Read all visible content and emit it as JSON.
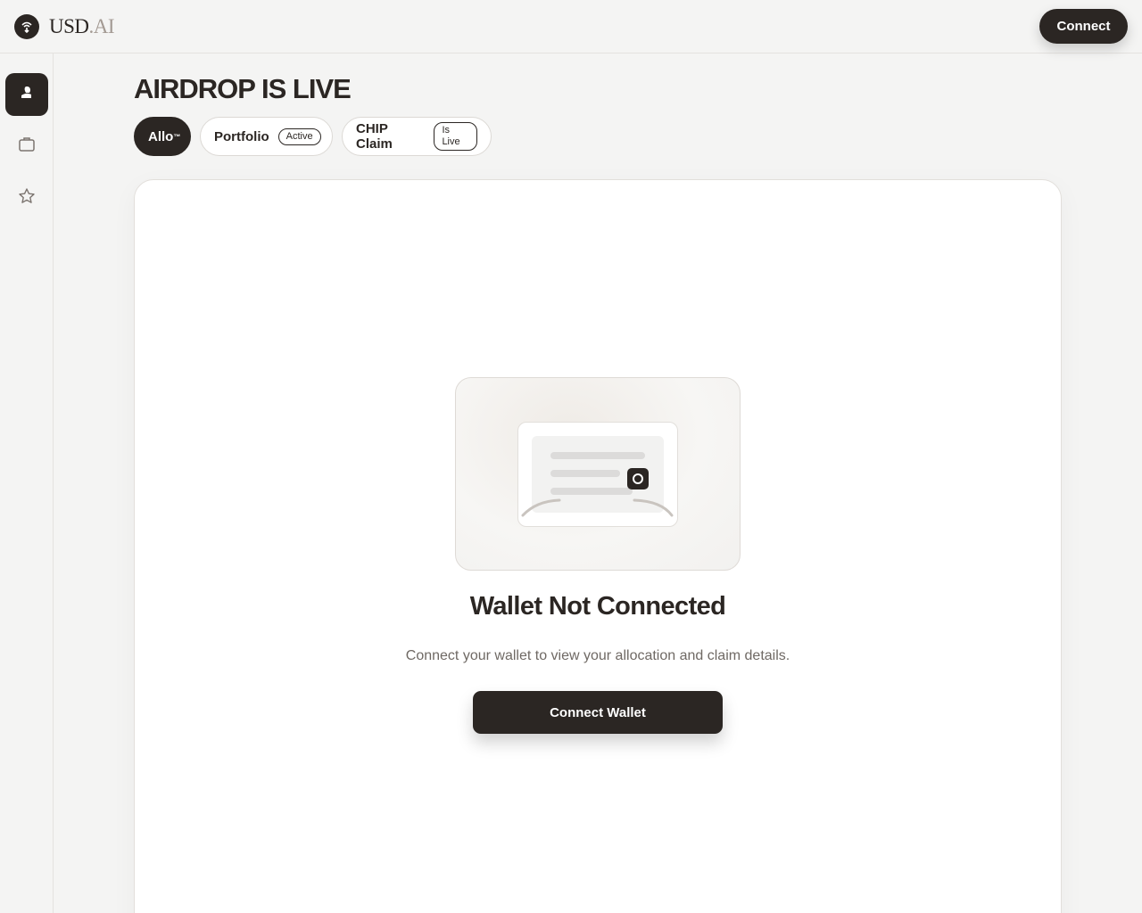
{
  "header": {
    "logo_main": "USD",
    "logo_ai": ".AI",
    "connect_label": "Connect"
  },
  "sidebar": {
    "items": [
      {
        "icon": "airdrop-icon",
        "active": true
      },
      {
        "icon": "briefcase-icon",
        "active": false
      },
      {
        "icon": "star-icon",
        "active": false
      }
    ]
  },
  "main": {
    "title": "AIRDROP IS LIVE",
    "tabs": [
      {
        "label": "Allo",
        "suffix": "™",
        "badge": ""
      },
      {
        "label": "Portfolio",
        "badge": "Active"
      },
      {
        "label": "CHIP Claim",
        "badge": "Is Live"
      }
    ],
    "empty_state": {
      "title": "Wallet Not Connected",
      "description": "Connect your wallet to view your allocation and claim details.",
      "button_label": "Connect Wallet"
    }
  },
  "colors": {
    "primary": "#2b2623",
    "background": "#f4f4f3",
    "panel": "#ffffff",
    "muted_text": "#6f6964"
  }
}
